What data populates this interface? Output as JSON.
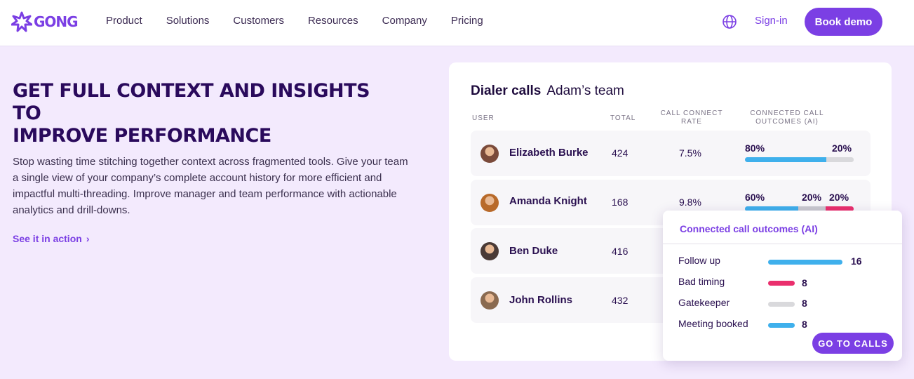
{
  "brand": {
    "name": "GONG",
    "accent": "#7b3fe4"
  },
  "nav": {
    "items": [
      "Product",
      "Solutions",
      "Customers",
      "Resources",
      "Company",
      "Pricing"
    ],
    "signin": "Sign-in",
    "book_demo": "Book demo",
    "globe_icon": "globe-icon"
  },
  "hero": {
    "headline_line1": "GET FULL CONTEXT AND INSIGHTS TO",
    "headline_line2": "IMPROVE PERFORMANCE",
    "description": "Stop wasting time stitching together context across fragmented tools. Give your team a single view of your company’s complete account history for more efficient and impactful multi-threading. Improve manager and team performance with actionable analytics and drill-downs.",
    "cta": "See it in action",
    "cta_icon": "chevron-right-icon"
  },
  "card": {
    "title": "Dialer calls",
    "subtitle": "Adam’s team",
    "columns": {
      "user": "USER",
      "total": "TOTAL",
      "rate_line1": "CALL CONNECT",
      "rate_line2": "RATE",
      "outcomes_line1": "CONNECTED CALL",
      "outcomes_line2": "OUTCOMES (AI)"
    },
    "rows": [
      {
        "name": "Elizabeth Burke",
        "total": "424",
        "rate": "7.5%",
        "pcts": [
          "80%",
          "20%"
        ],
        "fractions": [
          0.75,
          0.25
        ],
        "colors": [
          "#3fb0ec",
          "#d9d9dc"
        ],
        "avatar": "#7a4a3a"
      },
      {
        "name": "Amanda Knight",
        "total": "168",
        "rate": "9.8%",
        "pcts": [
          "60%",
          "20%",
          "20%"
        ],
        "fractions": [
          0.49,
          0.25,
          0.26
        ],
        "colors": [
          "#3fb0ec",
          "#c9c9cf",
          "#ea2f6d"
        ],
        "avatar": "#b86a2a"
      },
      {
        "name": "Ben Duke",
        "total": "416",
        "rate": "",
        "pcts": [],
        "fractions": [],
        "colors": [],
        "avatar": "#4a3a36"
      },
      {
        "name": "John Rollins",
        "total": "432",
        "rate": "",
        "pcts": [],
        "fractions": [],
        "colors": [],
        "avatar": "#8a6a50"
      }
    ]
  },
  "popup": {
    "title": "Connected call outcomes (AI)",
    "items": [
      {
        "label": "Follow up",
        "value": "16",
        "color": "#3fb0ec"
      },
      {
        "label": "Bad timing",
        "value": "8",
        "color": "#ea2f6d"
      },
      {
        "label": "Gatekeeper",
        "value": "8",
        "color": "#d9d9dc"
      },
      {
        "label": "Meeting booked",
        "value": "8",
        "color": "#3fb0ec"
      }
    ],
    "button": "GO TO CALLS"
  }
}
